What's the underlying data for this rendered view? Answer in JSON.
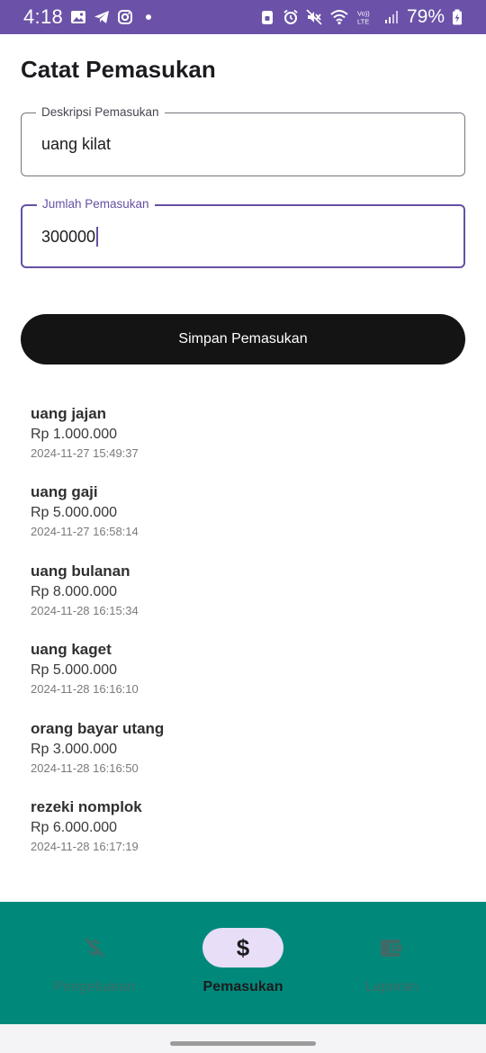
{
  "status_bar": {
    "time": "4:18",
    "battery": "79%",
    "left_icons": [
      "gallery-icon",
      "telegram-icon",
      "instagram-icon",
      "notification-dot"
    ],
    "right_icons": [
      "lock-icon",
      "alarm-icon",
      "mute-icon",
      "wifi-icon",
      "volte-icon",
      "signal-icon",
      "battery-icon"
    ],
    "network_label": "Vo)) LTE"
  },
  "page": {
    "title": "Catat Pemasukan"
  },
  "form": {
    "description": {
      "label": "Deskripsi Pemasukan",
      "value": "uang kilat"
    },
    "amount": {
      "label": "Jumlah Pemasukan",
      "value": "300000",
      "focused": true
    },
    "save_label": "Simpan Pemasukan"
  },
  "income_list": [
    {
      "description": "uang jajan",
      "amount": "Rp 1.000.000",
      "date": "2024-11-27 15:49:37"
    },
    {
      "description": "uang gaji",
      "amount": "Rp 5.000.000",
      "date": "2024-11-27 16:58:14"
    },
    {
      "description": "uang bulanan",
      "amount": "Rp 8.000.000",
      "date": "2024-11-28 16:15:34"
    },
    {
      "description": "uang kaget",
      "amount": "Rp 5.000.000",
      "date": "2024-11-28 16:16:10"
    },
    {
      "description": "orang bayar utang",
      "amount": "Rp 3.000.000",
      "date": "2024-11-28 16:16:50"
    },
    {
      "description": "rezeki nomplok",
      "amount": "Rp 6.000.000",
      "date": "2024-11-28 16:17:19"
    }
  ],
  "bottom_nav": {
    "items": [
      {
        "label": "Pengeluaran",
        "icon": "money-off-icon",
        "active": false
      },
      {
        "label": "Pemasukan",
        "icon": "dollar-icon",
        "active": true
      },
      {
        "label": "Laporan",
        "icon": "wallet-icon",
        "active": false
      }
    ]
  },
  "colors": {
    "status_bar": "#6b52a8",
    "accent": "#6750a4",
    "button": "#141414",
    "nav_background": "#00897b",
    "nav_active_pill": "#e8def8"
  }
}
